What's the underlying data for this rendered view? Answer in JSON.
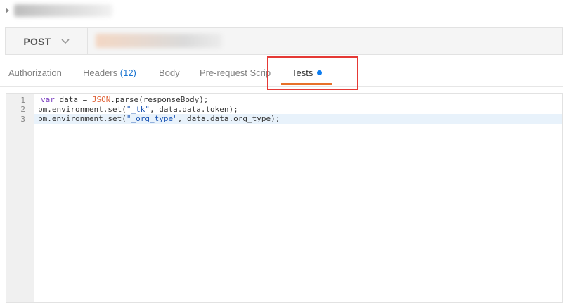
{
  "method": {
    "label": "POST"
  },
  "tabs": {
    "authorization": "Authorization",
    "headers": "Headers",
    "headers_count": "(12)",
    "body": "Body",
    "prerequest": "Pre-request Script",
    "tests": "Tests"
  },
  "editor": {
    "line_numbers": [
      "1",
      "2",
      "3"
    ],
    "lines": [
      {
        "kw": "var",
        "pre": " data = ",
        "builtin": "JSON",
        "post": ".parse(responseBody);"
      },
      {
        "pre": "pm.environment.set(",
        "str": "\"_tk\"",
        "post": ", data.data.token);"
      },
      {
        "pre": "pm.environment.set(",
        "str": "\"_org_type\"",
        "post": ", data.data.org_type);"
      }
    ]
  },
  "colors": {
    "accent_underline": "#e8712a",
    "unsaved_dot": "#0d7df0",
    "highlight_border": "#e53935",
    "headers_count": "#1a75d1"
  },
  "icons": {
    "method_dropdown": "chevron-down-icon",
    "collapse": "caret-right-icon"
  }
}
